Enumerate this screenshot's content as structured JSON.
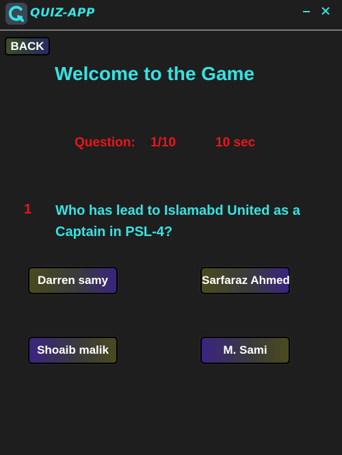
{
  "window": {
    "title": "QUIZ-APP",
    "minimize_icon": "minimize-icon",
    "close_icon": "close-icon",
    "logo_icon": "app-logo-icon"
  },
  "nav": {
    "back_label": "BACK"
  },
  "header": {
    "welcome": "Welcome to the Game"
  },
  "status": {
    "question_label": "Question:",
    "question_count": "1/10",
    "timer": "10 sec"
  },
  "question": {
    "number": "1",
    "text": "Who has lead to Islamabd United as a Captain in PSL-4?"
  },
  "options": [
    "Darren samy",
    "Sarfaraz Ahmed",
    "Shoaib malik",
    "M. Sami"
  ],
  "colors": {
    "background": "#1e1e1e",
    "accent_cyan": "#35e3e3",
    "accent_red": "#e8161c",
    "button_text": "#ffffff"
  }
}
